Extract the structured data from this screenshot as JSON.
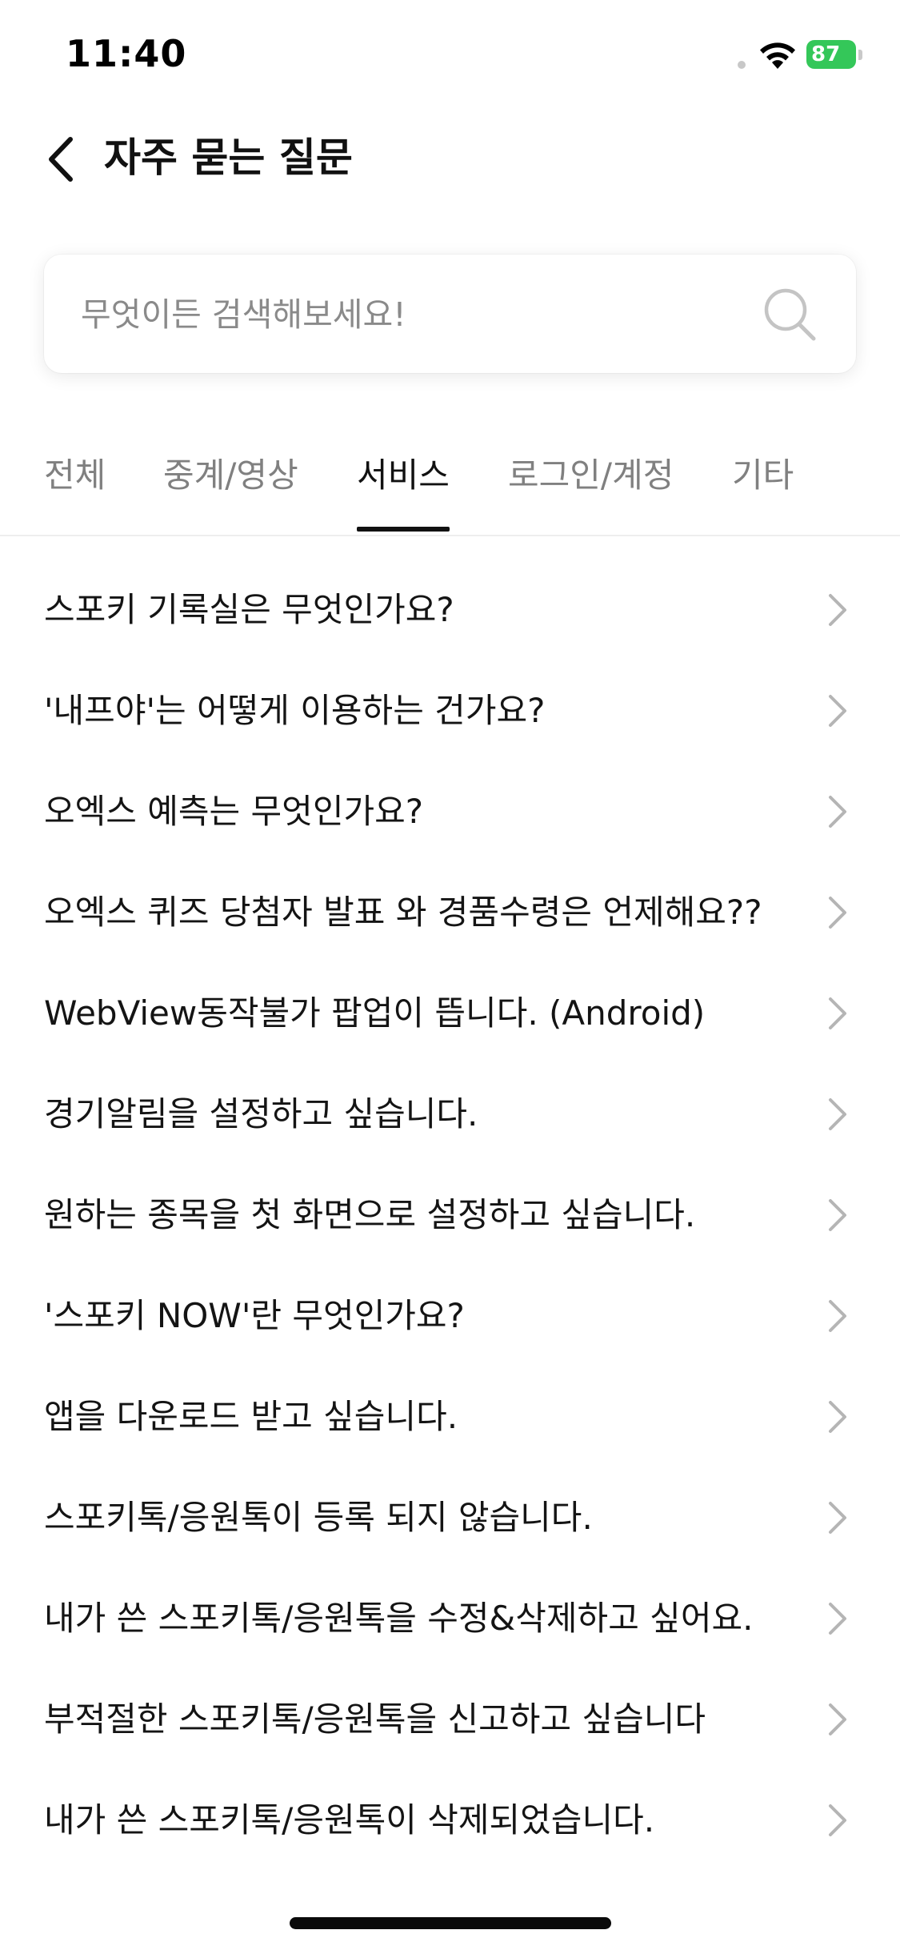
{
  "status_bar": {
    "time": "11:40",
    "battery_level": "87"
  },
  "header": {
    "title": "자주 묻는 질문",
    "back_icon": "chevron-left-icon"
  },
  "search": {
    "placeholder": "무엇이든 검색해보세요!",
    "value": "",
    "icon": "search-icon"
  },
  "tabs": [
    {
      "label": "전체",
      "active": false
    },
    {
      "label": "중계/영상",
      "active": false
    },
    {
      "label": "서비스",
      "active": true
    },
    {
      "label": "로그인/계정",
      "active": false
    },
    {
      "label": "기타",
      "active": false
    }
  ],
  "faq_items": [
    "스포키 기록실은 무엇인가요?",
    "'내프야'는 어떻게 이용하는 건가요?",
    "오엑스 예측는 무엇인가요?",
    "오엑스 퀴즈 당첨자 발표 와 경품수령은 언제해요??",
    "WebView동작불가 팝업이 뜹니다. (Android)",
    "경기알림을 설정하고 싶습니다.",
    "원하는 종목을 첫 화면으로 설정하고 싶습니다.",
    "'스포키 NOW'란 무엇인가요?",
    "앱을 다운로드 받고 싶습니다.",
    "스포키톡/응원톡이 등록 되지 않습니다.",
    "내가 쓴 스포키톡/응원톡을 수정&삭제하고 싶어요.",
    "부적절한 스포키톡/응원톡을 신고하고 싶습니다",
    "내가 쓴 스포키톡/응원톡이 삭제되었습니다."
  ],
  "colors": {
    "accent": "#111111",
    "battery": "#34c759",
    "inactive_tab": "#808080",
    "chevron": "#b5b5b5"
  }
}
